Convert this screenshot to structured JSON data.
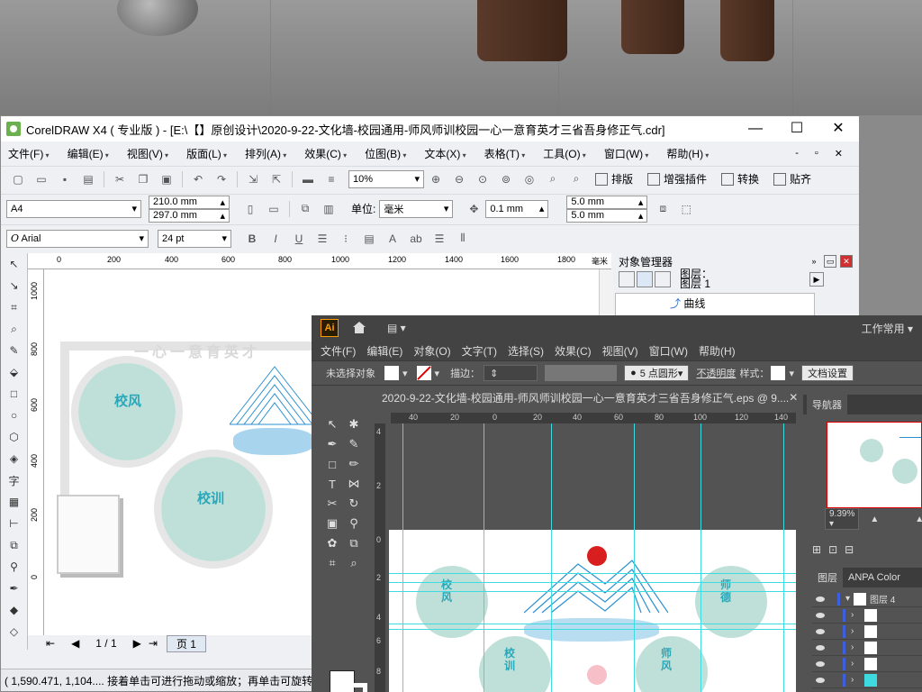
{
  "colors": {
    "corel_bg": "#eef0f4",
    "ai_bg": "#535353",
    "ai_accent": "#ff9a00",
    "design_teal": "#bfe0d8",
    "design_text": "#2aa7b8",
    "guide_cyan": "#3ddbe0",
    "mountain_blue": "#2b8fd0",
    "sun_red": "#d81e1e"
  },
  "corel": {
    "title": "CorelDRAW X4 ( 专业版 ) - [E:\\【】原创设计\\2020-9-22-文化墙-校园通用-师风师训校园一心一意育英才三省吾身修正气.cdr]",
    "window_controls": [
      "—",
      "☐",
      "✕"
    ],
    "menus": [
      "文件(F)",
      "编辑(E)",
      "视图(V)",
      "版面(L)",
      "排列(A)",
      "效果(C)",
      "位图(B)",
      "文本(X)",
      "表格(T)",
      "工具(O)",
      "窗口(W)",
      "帮助(H)"
    ],
    "menu_right": [
      "-",
      "▫",
      "✕"
    ],
    "toolbar1": {
      "zoom": "10%",
      "buttons": [
        "排版",
        "增强插件",
        "转换",
        "贴齐"
      ]
    },
    "property_bar": {
      "page_size": "A4",
      "width": "210.0 mm",
      "height": "297.0 mm",
      "unit_label": "单位:",
      "unit": "毫米",
      "nudge": "0.1 mm",
      "dup_x": "5.0 mm",
      "dup_y": "5.0 mm"
    },
    "text_bar": {
      "font": "Arial",
      "size": "24 pt"
    },
    "ruler_h": [
      "200",
      "400",
      "600",
      "800",
      "1000",
      "1200",
      "1400",
      "1600",
      "1800",
      "毫米"
    ],
    "ruler_v": [
      "1000",
      "800",
      "600",
      "400",
      "200",
      "0"
    ],
    "ruler_h_start": "0",
    "page_nav": "1 / 1",
    "page_tab": "页 1",
    "status": "( 1,590.471, 1,104.... 接着单击可进行拖动或缩放；再单击可旋转或倾",
    "docker": {
      "title": "对象管理器",
      "layer_line1": "图层：",
      "layer_line2": "图层 1",
      "tree_item": "曲线"
    },
    "design": {
      "slogan": "一心一意育英才",
      "circle1": "校风",
      "circle2": "校训"
    }
  },
  "ai": {
    "logo": "Ai",
    "workspace": "工作常用",
    "menus": [
      "文件(F)",
      "编辑(E)",
      "对象(O)",
      "文字(T)",
      "选择(S)",
      "效果(C)",
      "视图(V)",
      "窗口(W)",
      "帮助(H)"
    ],
    "control": {
      "no_selection": "未选择对象",
      "stroke_label": "描边：",
      "brush": "5 点圆形",
      "opacity": "不透明度",
      "style": "样式：",
      "doc_settings": "文档设置"
    },
    "doc_tab": "2020-9-22-文化墙-校园通用-师风师训校园一心一意育英才三省吾身修正气.eps @ 9....",
    "ruler_h": [
      "40",
      "20",
      "0",
      "20",
      "40",
      "60",
      "80",
      "100",
      "120",
      "140"
    ],
    "ruler_v": [
      "4",
      "2",
      "0",
      "2",
      "4",
      "6",
      "8"
    ],
    "navigator": {
      "title": "导航器",
      "zoom": "9.39%"
    },
    "layers": {
      "tabs": [
        "图层",
        "ANPA Color"
      ],
      "top_layer": "图层 4"
    },
    "design": {
      "circle1": "校风",
      "circle2": "校训",
      "circle3": "师德",
      "circle4": "师风"
    }
  }
}
